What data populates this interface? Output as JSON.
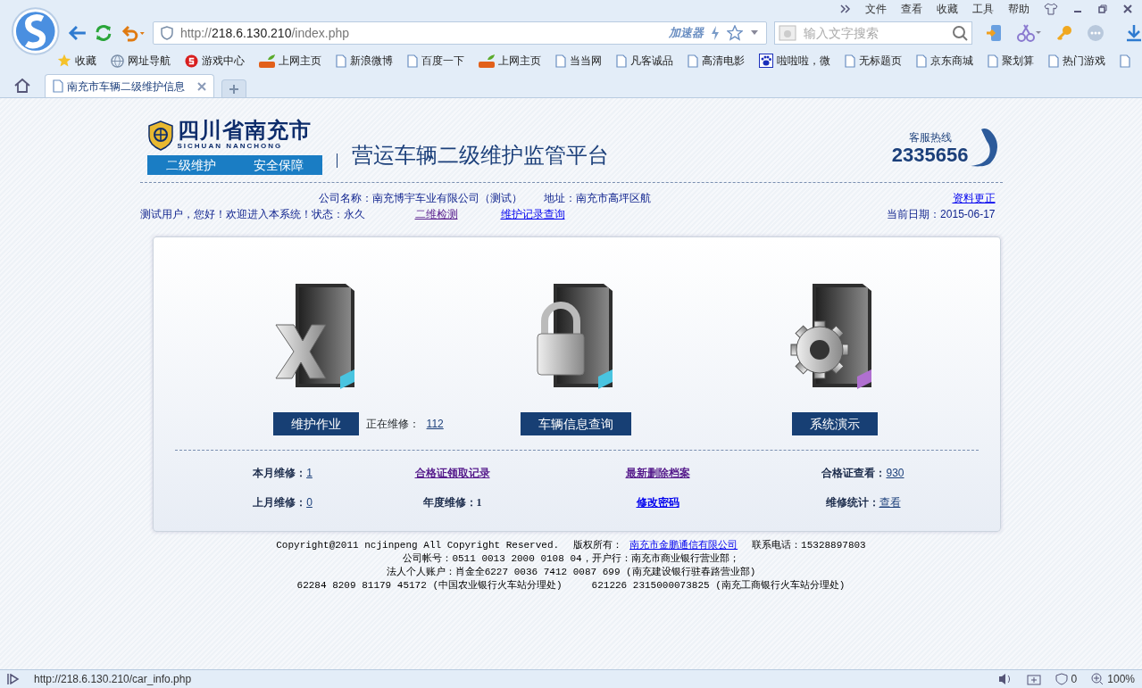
{
  "browser": {
    "menu": [
      "文件",
      "查看",
      "收藏",
      "工具",
      "帮助"
    ],
    "address": {
      "prefix": "http://",
      "host": "218.6.130.210",
      "path": "/index.php"
    },
    "accelerator": "加速器",
    "search": {
      "placeholder": "输入文字搜索"
    },
    "bookmarks": [
      {
        "kind": "star",
        "label": "收藏"
      },
      {
        "kind": "globe",
        "label": "网址导航"
      },
      {
        "kind": "game",
        "label": "游戏中心"
      },
      {
        "kind": "hao",
        "label": "上网主页"
      },
      {
        "kind": "page",
        "label": "新浪微博"
      },
      {
        "kind": "page",
        "label": "百度一下"
      },
      {
        "kind": "hao",
        "label": "上网主页"
      },
      {
        "kind": "page",
        "label": "当当网"
      },
      {
        "kind": "page",
        "label": "凡客诚品"
      },
      {
        "kind": "page",
        "label": "高清电影"
      },
      {
        "kind": "paw",
        "label": "啦啦啦，微"
      },
      {
        "kind": "page",
        "label": "无标题页"
      },
      {
        "kind": "page",
        "label": "京东商城"
      },
      {
        "kind": "page",
        "label": "聚划算"
      },
      {
        "kind": "page",
        "label": "热门游戏"
      },
      {
        "kind": "page"
      }
    ],
    "tabs": [
      {
        "title": "南充市车辆二级维护信息",
        "selected": true
      }
    ],
    "status": {
      "url": "http://218.6.130.210/car_info.php",
      "blocked": "0",
      "zoom": "100%"
    }
  },
  "header": {
    "region": "四川省南充市",
    "region_en": "SICHUAN  NANCHONG",
    "banner": [
      "二级维护",
      "安全保障"
    ],
    "platform": "营运车辆二级维护监管平台",
    "hotline_label": "客服热线",
    "hotline": "2335656"
  },
  "info": {
    "company": "公司名称：南充博宇车业有限公司（测试）",
    "address": "地址：南充市高坪区航",
    "update_link": "资料更正",
    "welcome": "测试用户，您好！欢迎进入本系统！状态：永久",
    "links": [
      {
        "text": "二维检测",
        "visited": true
      },
      {
        "text": "维护记录查询",
        "visited": false
      }
    ],
    "date": "当前日期：2015-06-17"
  },
  "modules": [
    {
      "kind": "excel",
      "button": "维护作业",
      "note_label": "正在维修：",
      "note_value": "112"
    },
    {
      "kind": "lock",
      "button": "车辆信息查询"
    },
    {
      "kind": "gear",
      "button": "系统演示"
    }
  ],
  "stats": [
    [
      {
        "kind": "stat",
        "label": "本月维修：",
        "value": "1"
      },
      {
        "kind": "link",
        "text": "合格证领取记录",
        "visited": true
      },
      {
        "kind": "link",
        "text": "最新删除档案",
        "visited": true
      },
      {
        "kind": "stat",
        "label": "合格证查看：",
        "value": "930"
      }
    ],
    [
      {
        "kind": "stat",
        "label": "上月维修：",
        "value": "0"
      },
      {
        "kind": "plain",
        "label": "年度维修：",
        "value": "1"
      },
      {
        "kind": "link",
        "text": "修改密码",
        "visited": false
      },
      {
        "kind": "stat",
        "label": "维修统计：",
        "value": "查看"
      }
    ]
  ],
  "footer": {
    "copyright": "Copyright@2011 ncjinpeng All Copyright Reserved.",
    "owner_label": "版权所有：",
    "owner": "南充市金鹏通信有限公司",
    "phone": "联系电话：15328897803",
    "lines": [
      "公司帐号：0511 0013 2000 0108 04，开户行：南充市商业银行营业部；",
      "法人个人账户：肖金全6227 0036 7412 0087 699 (南充建设银行驻春路营业部)",
      "62284 8209 81179 45172 (中国农业银行火车站分理处)　　　621226 2315000073825 (南充工商银行火车站分理处)"
    ]
  }
}
